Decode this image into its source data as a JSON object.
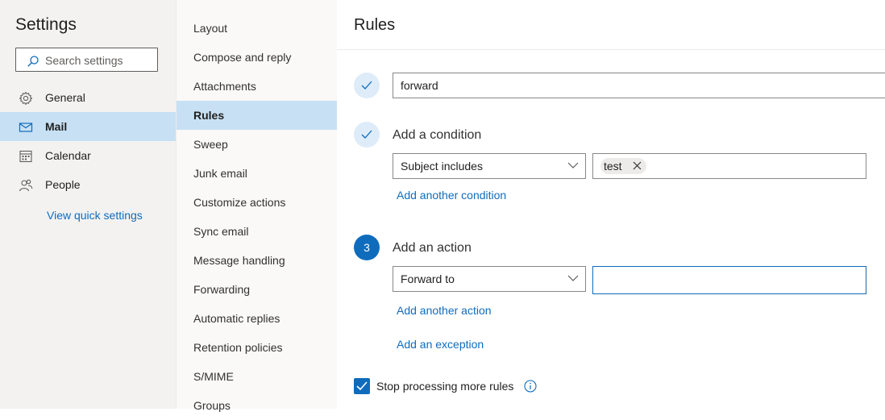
{
  "settings": {
    "title": "Settings",
    "search_placeholder": "Search settings",
    "nav": [
      {
        "label": "General",
        "icon": "gear-icon"
      },
      {
        "label": "Mail",
        "icon": "mail-icon",
        "selected": true
      },
      {
        "label": "Calendar",
        "icon": "calendar-icon"
      },
      {
        "label": "People",
        "icon": "people-icon"
      }
    ],
    "quick_settings": "View quick settings"
  },
  "mail_menu": {
    "items": [
      "Layout",
      "Compose and reply",
      "Attachments",
      "Rules",
      "Sweep",
      "Junk email",
      "Customize actions",
      "Sync email",
      "Message handling",
      "Forwarding",
      "Automatic replies",
      "Retention policies",
      "S/MIME",
      "Groups"
    ],
    "selected": "Rules"
  },
  "rules": {
    "heading": "Rules",
    "rule_name": "forward",
    "condition_label": "Add a condition",
    "condition_select": "Subject includes",
    "condition_chip": "test",
    "add_condition_link": "Add another condition",
    "step3_number": "3",
    "action_label": "Add an action",
    "action_select": "Forward to",
    "action_value": "",
    "add_action_link": "Add another action",
    "add_exception_link": "Add an exception",
    "stop_processing_label": "Stop processing more rules",
    "stop_processing_checked": true
  },
  "colors": {
    "accent": "#0f6cbd",
    "selected_bg": "#c7e0f4"
  }
}
